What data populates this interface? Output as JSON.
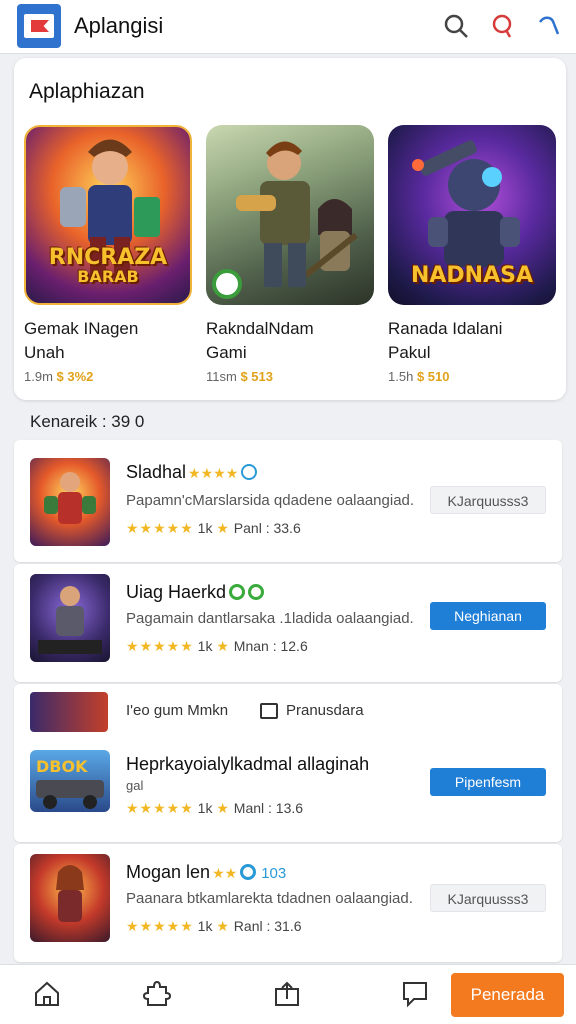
{
  "header": {
    "title": "Aplangisi",
    "icons": [
      "search-icon",
      "search-red-icon",
      "refresh-icon"
    ]
  },
  "featured": {
    "title": "Aplaphiazan",
    "games": [
      {
        "name_line1": "Gemak INagen",
        "name_line2": "Unah",
        "size": "1.9m",
        "price": "$ 3%2",
        "banner_line1": "RNCRAZA",
        "banner_line2": "BARAB"
      },
      {
        "name_line1": "RakndalNdam",
        "name_line2": "Gami",
        "size": "11sm",
        "price": "$ 513",
        "banner_line1": "",
        "banner_line2": ""
      },
      {
        "name_line1": "Ranada Idalani",
        "name_line2": "Pakul",
        "size": "1.5h",
        "price": "$ 510",
        "banner_line1": "NADNASA",
        "banner_line2": ""
      }
    ]
  },
  "section": {
    "label": "Kenareik : 39  0"
  },
  "list": [
    {
      "name": "Sladhal",
      "desc": "Papamn'cMarslarsida qdadene oalaangiad.",
      "rating_count": "1k",
      "meta": "Panl : 33.6",
      "button": "KJarquusss3",
      "button_style": "grey"
    },
    {
      "name": "Uiag Haerkd",
      "desc": "Pagamain dantlarsaka .1ladida oalaangiad.",
      "rating_count": "1k",
      "meta": "Mnan : 12.6",
      "button": "Neghianan",
      "button_style": "blue"
    },
    {
      "name": "Heprkayoialylkadmal allaginah",
      "sub": "gal",
      "promo_text": "I'eo gum Mmkn",
      "promo_tag": "Pranusdara",
      "rating_count": "1k",
      "meta": "Manl : 13.6",
      "button": "Pipenfesm",
      "button_style": "blue"
    },
    {
      "name": "Mogan len",
      "desc": "Paanara btkamlarekta tdadnen oalaangiad.",
      "rating_count": "1k",
      "meta": "Ranl : 31.6",
      "button": "KJarquusss3",
      "button_style": "grey",
      "badge_text": "103"
    }
  ],
  "bottom_nav": {
    "icons": [
      "home-icon",
      "puzzle-icon",
      "share-icon",
      "chat-icon"
    ],
    "cta": "Penerada"
  },
  "colors": {
    "accent": "#1f7ed6",
    "cta": "#f47a1f",
    "star": "#f2b824"
  }
}
